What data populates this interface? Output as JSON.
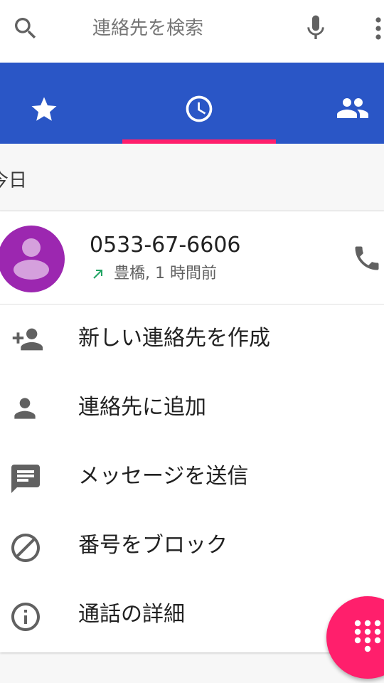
{
  "search": {
    "placeholder": "連絡先を検索"
  },
  "tabs": [
    {
      "name": "favorites",
      "icon": "star-icon",
      "selected": false
    },
    {
      "name": "recents",
      "icon": "clock-icon",
      "selected": true
    },
    {
      "name": "contacts",
      "icon": "people-icon",
      "selected": false
    }
  ],
  "section": {
    "label": "今日"
  },
  "call": {
    "number": "0533-67-6606",
    "meta": "豊橋, 1 時間前",
    "direction_icon": "outgoing-arrow-icon",
    "avatar_color": "#9c27b0"
  },
  "actions": [
    {
      "id": "create-contact",
      "icon": "person-add-icon",
      "label": "新しい連絡先を作成"
    },
    {
      "id": "add-to-contact",
      "icon": "person-icon",
      "label": "連絡先に追加"
    },
    {
      "id": "send-message",
      "icon": "message-icon",
      "label": "メッセージを送信"
    },
    {
      "id": "block-number",
      "icon": "block-icon",
      "label": "番号をブロック"
    },
    {
      "id": "call-details",
      "icon": "info-icon",
      "label": "通話の詳細"
    }
  ],
  "colors": {
    "tab_bar": "#2a56c6",
    "accent": "#ff1f6c",
    "outgoing": "#1fa463"
  }
}
